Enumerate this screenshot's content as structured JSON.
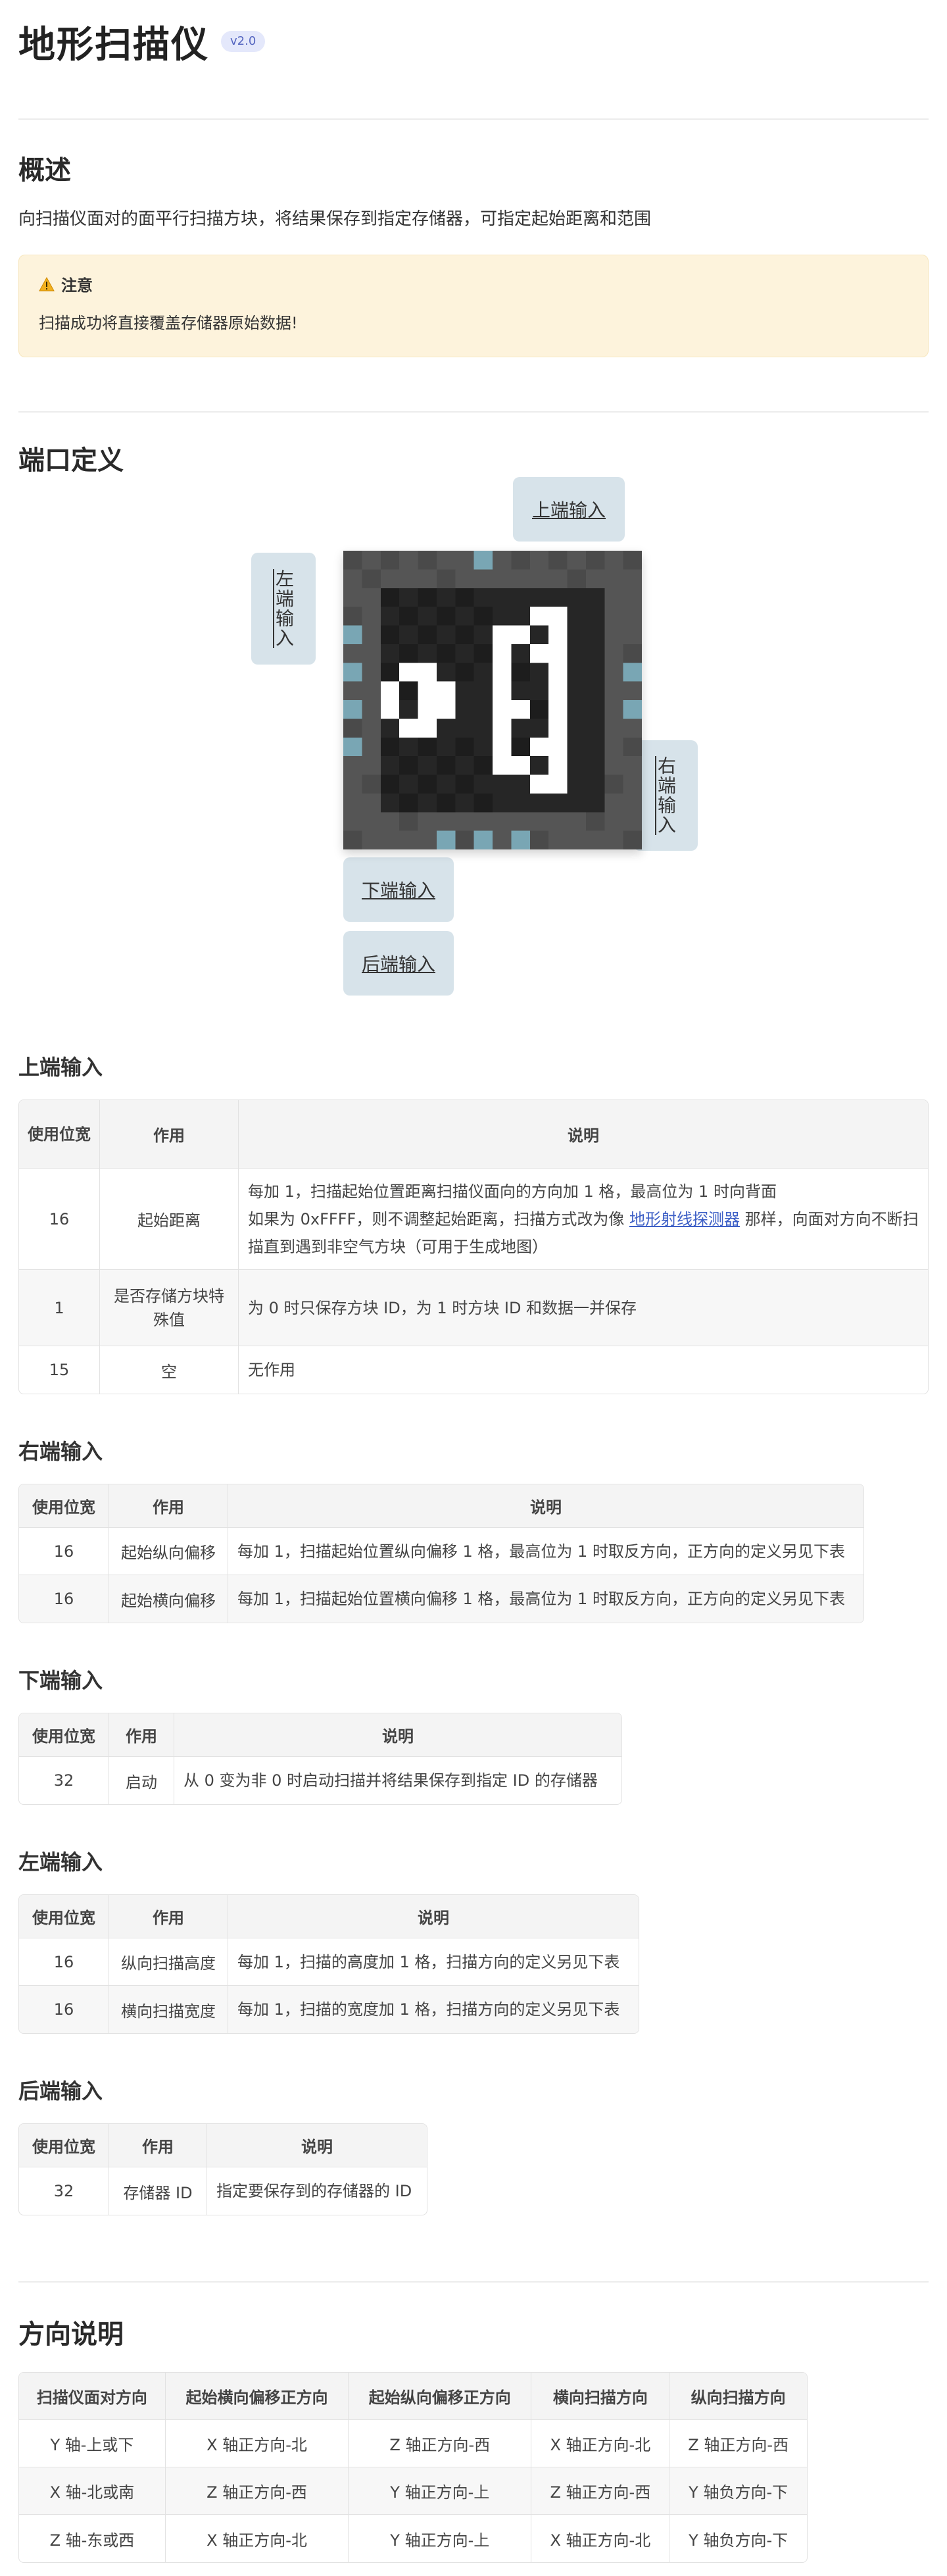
{
  "header": {
    "title": "地形扫描仪",
    "version": "v2.0"
  },
  "overview": {
    "heading": "概述",
    "description": "向扫描仪面对的面平行扫描方块，将结果保存到指定存储器，可指定起始距离和范围",
    "note_title": "注意",
    "note_text": "扫描成功将直接覆盖存储器原始数据!",
    "note_icon": "warning-icon"
  },
  "ports": {
    "heading": "端口定义",
    "top": "上端输入",
    "left": "左端输入",
    "right": "右端输入",
    "bottom": "下端输入",
    "back": "后端输入"
  },
  "top_input": {
    "heading": "上端输入",
    "headers": [
      "使用位宽",
      "作用",
      "说明"
    ],
    "rows": [
      {
        "width": "16",
        "role": "起始距离",
        "line1": "每加 1，扫描起始位置距离扫描仪面向的方向加 1 格，最高位为 1 时向背面",
        "line2_pre": "如果为 0xFFFF，则不调整起始距离，扫描方式改为像",
        "line2_link": "地形射线探测器",
        "line2_post": "那样，向面对方向不断扫描直到遇到非空气方块（可用于生成地图）"
      },
      {
        "width": "1",
        "role": "是否存储方块特殊值",
        "desc": "为 0 时只保存方块 ID，为 1 时方块 ID 和数据一并保存"
      },
      {
        "width": "15",
        "role": "空",
        "desc": "无作用"
      }
    ]
  },
  "right_input": {
    "heading": "右端输入",
    "headers": [
      "使用位宽",
      "作用",
      "说明"
    ],
    "rows": [
      {
        "width": "16",
        "role": "起始纵向偏移",
        "desc": "每加 1，扫描起始位置纵向偏移 1 格，最高位为 1 时取反方向，正方向的定义另见下表"
      },
      {
        "width": "16",
        "role": "起始横向偏移",
        "desc": "每加 1，扫描起始位置横向偏移 1 格，最高位为 1 时取反方向，正方向的定义另见下表"
      }
    ]
  },
  "bottom_input": {
    "heading": "下端输入",
    "headers": [
      "使用位宽",
      "作用",
      "说明"
    ],
    "rows": [
      {
        "width": "32",
        "role": "启动",
        "desc": "从 0 变为非 0 时启动扫描并将结果保存到指定 ID 的存储器"
      }
    ]
  },
  "left_input": {
    "heading": "左端输入",
    "headers": [
      "使用位宽",
      "作用",
      "说明"
    ],
    "rows": [
      {
        "width": "16",
        "role": "纵向扫描高度",
        "desc": "每加 1，扫描的高度加 1 格，扫描方向的定义另见下表"
      },
      {
        "width": "16",
        "role": "横向扫描宽度",
        "desc": "每加 1，扫描的宽度加 1 格，扫描方向的定义另见下表"
      }
    ]
  },
  "back_input": {
    "heading": "后端输入",
    "headers": [
      "使用位宽",
      "作用",
      "说明"
    ],
    "rows": [
      {
        "width": "32",
        "role": "存储器 ID",
        "desc": "指定要保存到的存储器的 ID"
      }
    ]
  },
  "direction": {
    "heading": "方向说明",
    "headers": [
      "扫描仪面对方向",
      "起始横向偏移正方向",
      "起始纵向偏移正方向",
      "横向扫描方向",
      "纵向扫描方向"
    ],
    "rows": [
      [
        "Y 轴-上或下",
        "X 轴正方向-北",
        "Z 轴正方向-西",
        "X 轴正方向-北",
        "Z 轴正方向-西"
      ],
      [
        "X 轴-北或南",
        "Z 轴正方向-西",
        "Y 轴正方向-上",
        "Z 轴正方向-西",
        "Y 轴负方向-下"
      ],
      [
        "Z 轴-东或西",
        "X 轴正方向-北",
        "Y 轴正方向-上",
        "X 轴正方向-北",
        "Y 轴负方向-下"
      ]
    ]
  }
}
